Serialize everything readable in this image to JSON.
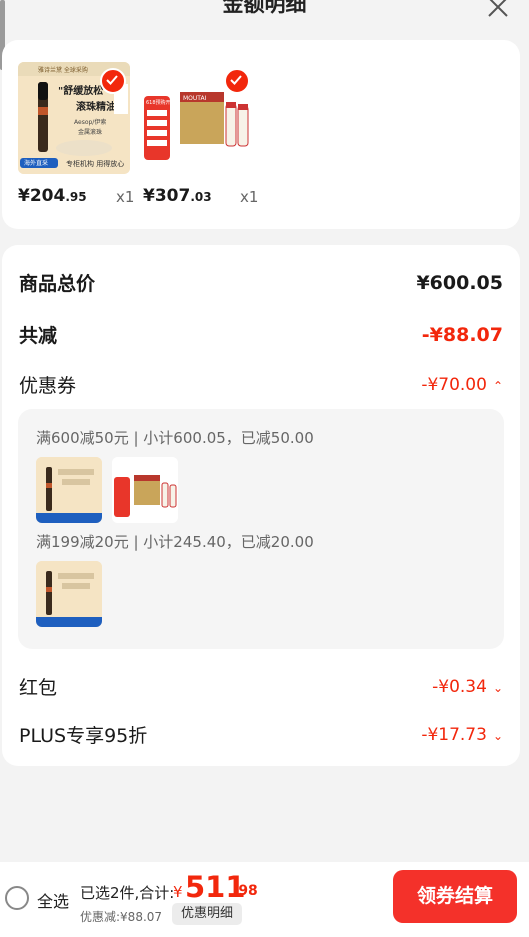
{
  "header": {
    "title": "金额明细"
  },
  "products": [
    {
      "price_int": "¥204",
      "price_dec": ".95",
      "qty": "x1",
      "img_text": {
        "banner": "雅诗兰黛 全球采购",
        "headline": "\"舒缓放松\"",
        "sub": "滚珠精油",
        "brand": "Aesop/伊索",
        "note": "金属滚珠",
        "corner": "海外直采",
        "footer": "专柜机构 用得放心"
      }
    },
    {
      "price_int": "¥307",
      "price_dec": ".03",
      "qty": "x1",
      "img_text": {
        "badge": "618预购开抢",
        "brand": "MOUTAI"
      }
    }
  ],
  "summary": {
    "total_label": "商品总价",
    "total_value": "¥600.05",
    "reduce_label": "共减",
    "reduce_value": "-¥88.07",
    "coupon_label": "优惠券",
    "coupon_value": "-¥70.00",
    "coupon_groups": [
      {
        "text": "满600减50元 | 小计600.05，已减50.00"
      },
      {
        "text": "满199减20元 | 小计245.40，已减20.00"
      }
    ],
    "redpacket_label": "红包",
    "redpacket_value": "-¥0.34",
    "plus_label": "PLUS专享95折",
    "plus_value": "-¥17.73"
  },
  "bottom": {
    "select_all": "全选",
    "selected_text": "已选2件,合计:",
    "total_yen": "¥",
    "total_int": "511",
    "total_dec": ".98",
    "discount_text": "优惠减:¥88.07",
    "detail_tag": "优惠明细",
    "checkout": "领券结算"
  },
  "colors": {
    "accent": "#f2270c",
    "background": "#f3f3f3"
  }
}
